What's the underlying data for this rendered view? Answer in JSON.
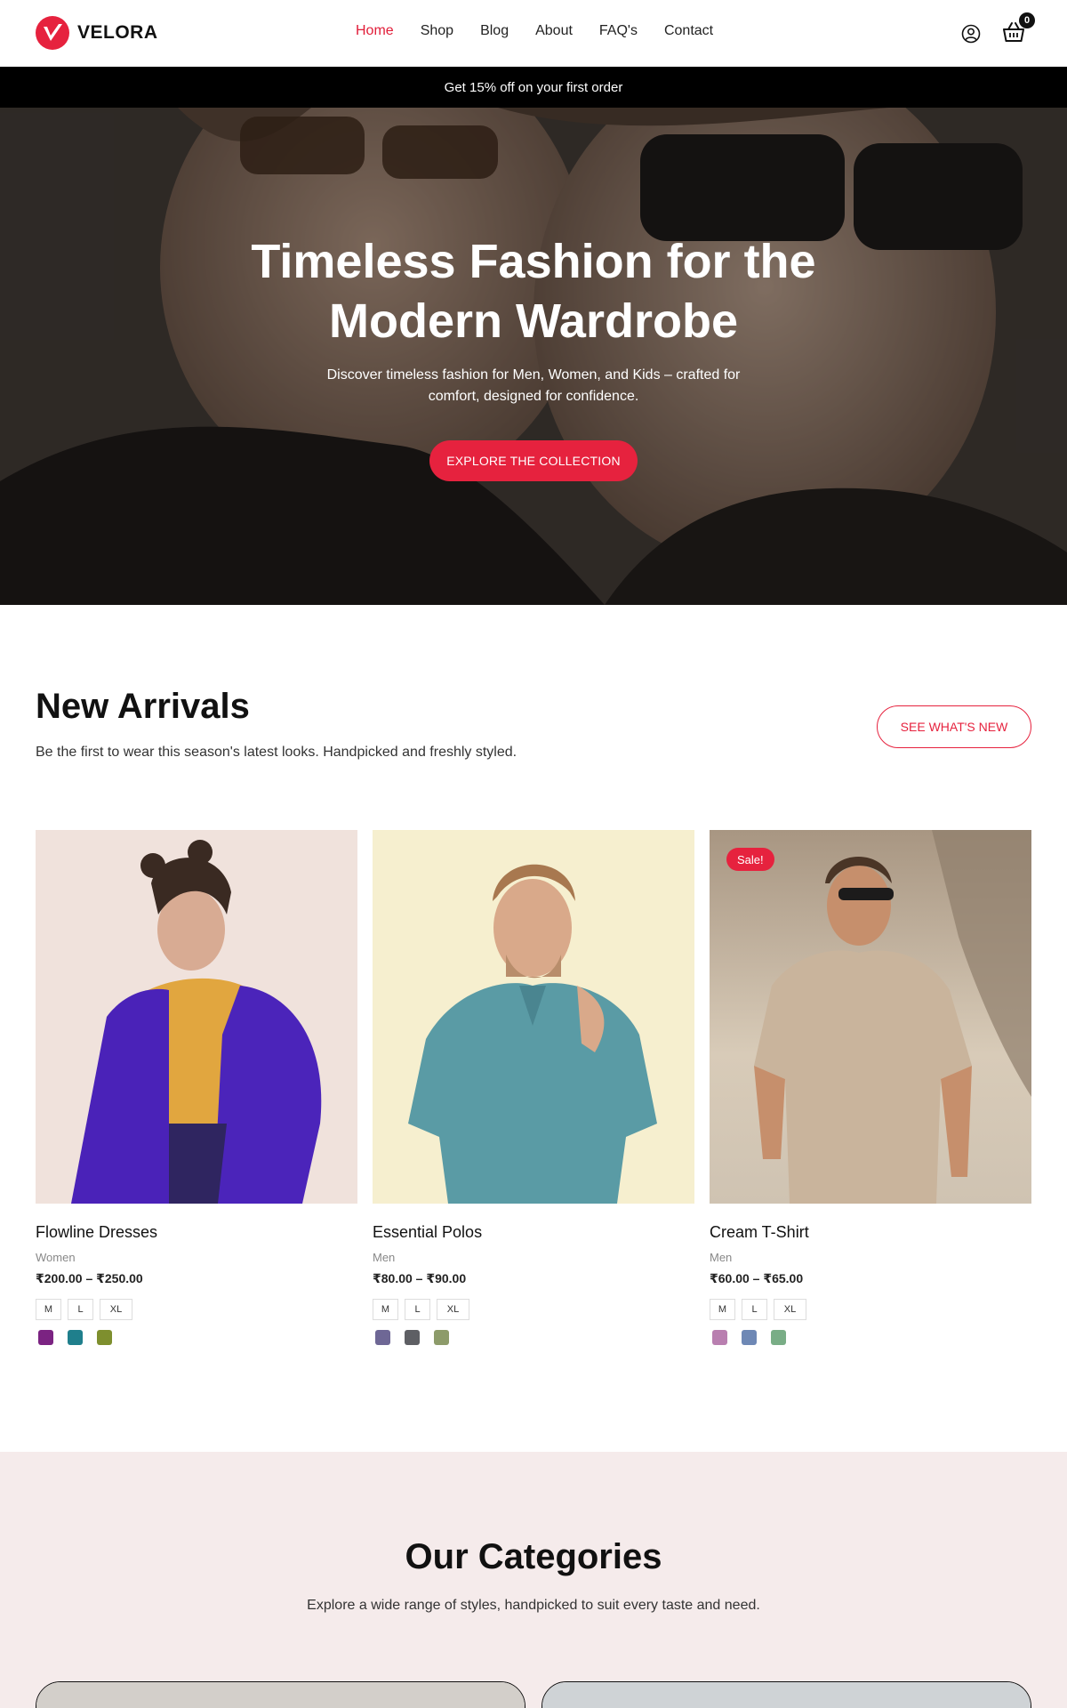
{
  "brand": {
    "name": "VELORA",
    "accent": "#e6223e"
  },
  "nav": {
    "items": [
      {
        "label": "Home",
        "active": true
      },
      {
        "label": "Shop",
        "active": false
      },
      {
        "label": "Blog",
        "active": false
      },
      {
        "label": "About",
        "active": false
      },
      {
        "label": "FAQ's",
        "active": false
      },
      {
        "label": "Contact",
        "active": false
      }
    ],
    "cart_count": "0"
  },
  "promo": {
    "text": "Get 15% off on your first order"
  },
  "hero": {
    "title": "Timeless Fashion for the Modern Wardrobe",
    "subtitle": "Discover timeless fashion for Men, Women, and Kids – crafted for comfort, designed for confidence.",
    "button": "EXPLORE THE COLLECTION"
  },
  "new_arrivals": {
    "title": "New Arrivals",
    "subtitle": "Be the first to wear this season's latest looks. Handpicked and freshly styled.",
    "button": "SEE WHAT'S NEW",
    "products": [
      {
        "name": "Flowline Dresses",
        "category": "Women",
        "price": "₹200.00 – ₹250.00",
        "sizes": [
          "M",
          "L",
          "XL"
        ],
        "colors": [
          "#7b2382",
          "#1f7f8c",
          "#7e8f2e"
        ],
        "sale": ""
      },
      {
        "name": "Essential Polos",
        "category": "Men",
        "price": "₹80.00 – ₹90.00",
        "sizes": [
          "M",
          "L",
          "XL"
        ],
        "colors": [
          "#6e6795",
          "#5e5f64",
          "#8d9b6a"
        ],
        "sale": ""
      },
      {
        "name": "Cream T-Shirt",
        "category": "Men",
        "price": "₹60.00 – ₹65.00",
        "sizes": [
          "M",
          "L",
          "XL"
        ],
        "colors": [
          "#b97fb0",
          "#6e88b5",
          "#79ad86"
        ],
        "sale": "Sale!"
      }
    ]
  },
  "categories": {
    "title": "Our Categories",
    "subtitle": "Explore a wide range of styles, handpicked to suit every taste and need."
  }
}
